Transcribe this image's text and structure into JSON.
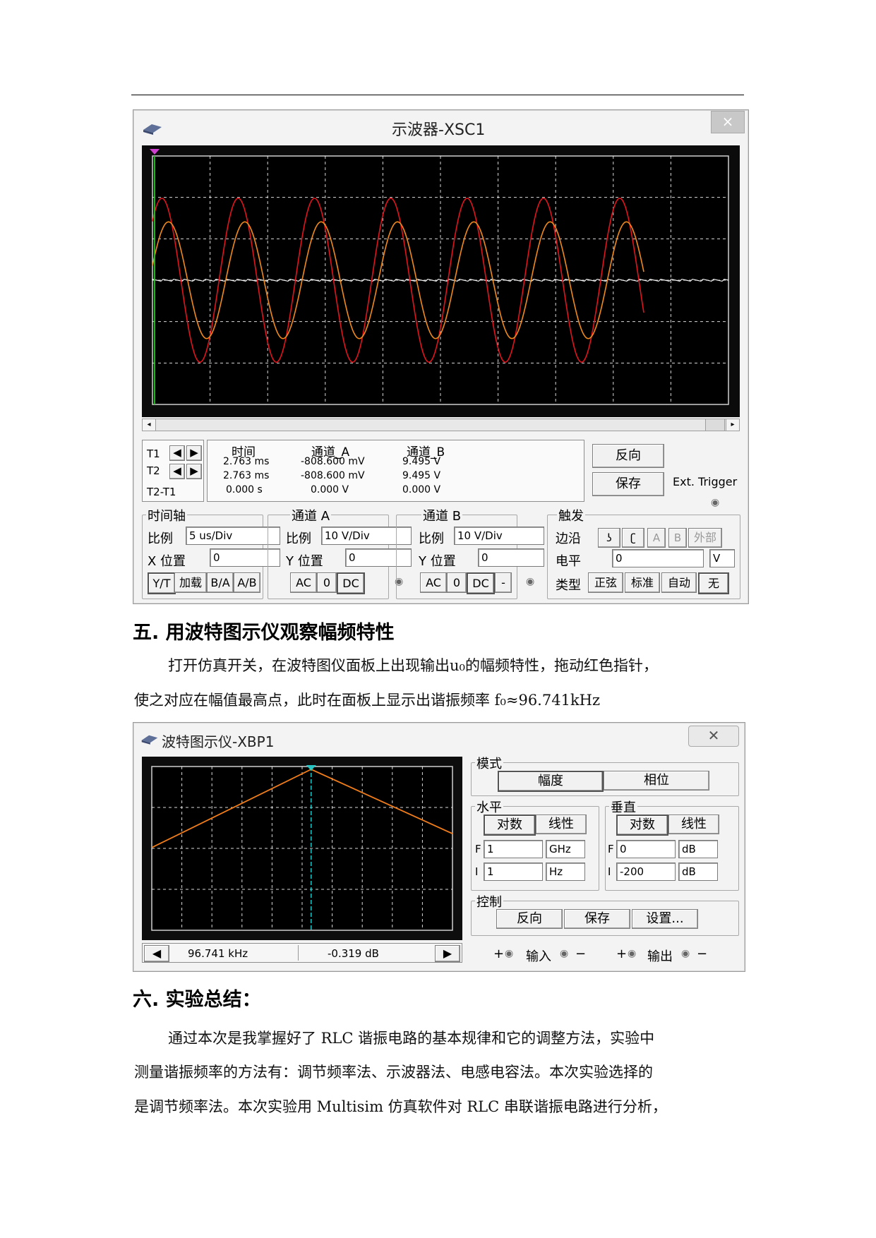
{
  "oscilloscope": {
    "title": "示波器-XSC1",
    "close": "×",
    "readout": {
      "headers": [
        "时间",
        "通道_A",
        "通道_B"
      ],
      "rows": [
        {
          "label": "T1",
          "time": "2.763 ms",
          "a": "-808.600 mV",
          "b": "9.495 V"
        },
        {
          "label": "T2",
          "time": "2.763 ms",
          "a": "-808.600 mV",
          "b": "9.495 V"
        },
        {
          "label": "T2-T1",
          "time": "0.000 s",
          "a": "0.000 V",
          "b": "0.000 V"
        }
      ]
    },
    "reverse_label": "反向",
    "save_label": "保存",
    "ext_trigger": "Ext. Trigger",
    "timebase": {
      "title": "时间轴",
      "scale_label": "比例",
      "scale": "5 us/Div",
      "xpos_label": "X 位置",
      "xpos": "0",
      "buttons": [
        "Y/T",
        "加载",
        "B/A",
        "A/B"
      ]
    },
    "channel_a": {
      "title": "通道 A",
      "scale_label": "比例",
      "scale": "10  V/Div",
      "ypos_label": "Y 位置",
      "ypos": "0",
      "buttons": [
        "AC",
        "0",
        "DC"
      ]
    },
    "channel_b": {
      "title": "通道 B",
      "scale_label": "比例",
      "scale": "10  V/Div",
      "ypos_label": "Y 位置",
      "ypos": "0",
      "buttons": [
        "AC",
        "0",
        "DC",
        "-"
      ]
    },
    "trigger": {
      "title": "触发",
      "edge_label": "边沿",
      "level_label": "电平",
      "level": "0",
      "unit": "V",
      "type_label": "类型",
      "edge_buttons": [
        "ʖ",
        "ʗ",
        "A",
        "B",
        "外部"
      ],
      "type_buttons": [
        "正弦",
        "标准",
        "自动",
        "无"
      ]
    },
    "colors": {
      "screen": "#000000",
      "trace_a": "#e0141c",
      "trace_b": "#f08a1c",
      "grid": "#ffffff",
      "cursor": "#22c81e"
    }
  },
  "section5": {
    "heading": "五. 用波特图示仪观察幅频特性",
    "line1": "打开仿真开关，在波特图仪面板上出现输出u₀的幅频特性，拖动红色指针，",
    "line2": "使之对应在幅值最高点，此时在面板上显示出谐振频率 f₀≈96.741kHz"
  },
  "bode": {
    "title": "波特图示仪-XBP1",
    "close": "✕",
    "mode": {
      "title": "模式",
      "magnitude": "幅度",
      "phase": "相位"
    },
    "horizontal": {
      "title": "水平",
      "log": "对数",
      "linear": "线性",
      "f_label": "F",
      "f": "1",
      "f_unit": "GHz",
      "i_label": "I",
      "i": "1",
      "i_unit": "Hz"
    },
    "vertical": {
      "title": "垂直",
      "log": "对数",
      "linear": "线性",
      "f_label": "F",
      "f": "0",
      "f_unit": "dB",
      "i_label": "I",
      "i": "-200",
      "i_unit": "dB"
    },
    "control": {
      "title": "控制",
      "reverse": "反向",
      "save": "保存",
      "settings": "设置..."
    },
    "readout_freq": "96.741 kHz",
    "readout_db": "-0.319 dB",
    "io": {
      "plus": "+",
      "minus": "−",
      "input": "输入",
      "output": "输出"
    },
    "colors": {
      "curve": "#f07d1a",
      "cursor": "#27c4c4"
    }
  },
  "section6": {
    "heading": "六. 实验总结：",
    "line1": "通过本次是我掌握好了 RLC 谐振电路的基本规律和它的调整方法，实验中",
    "line2": "测量谐振频率的方法有：调节频率法、示波器法、电感电容法。本次实验选择的",
    "line3": "是调节频率法。本次实验用 Multisim 仿真软件对 RLC 串联谐振电路进行分析，"
  }
}
